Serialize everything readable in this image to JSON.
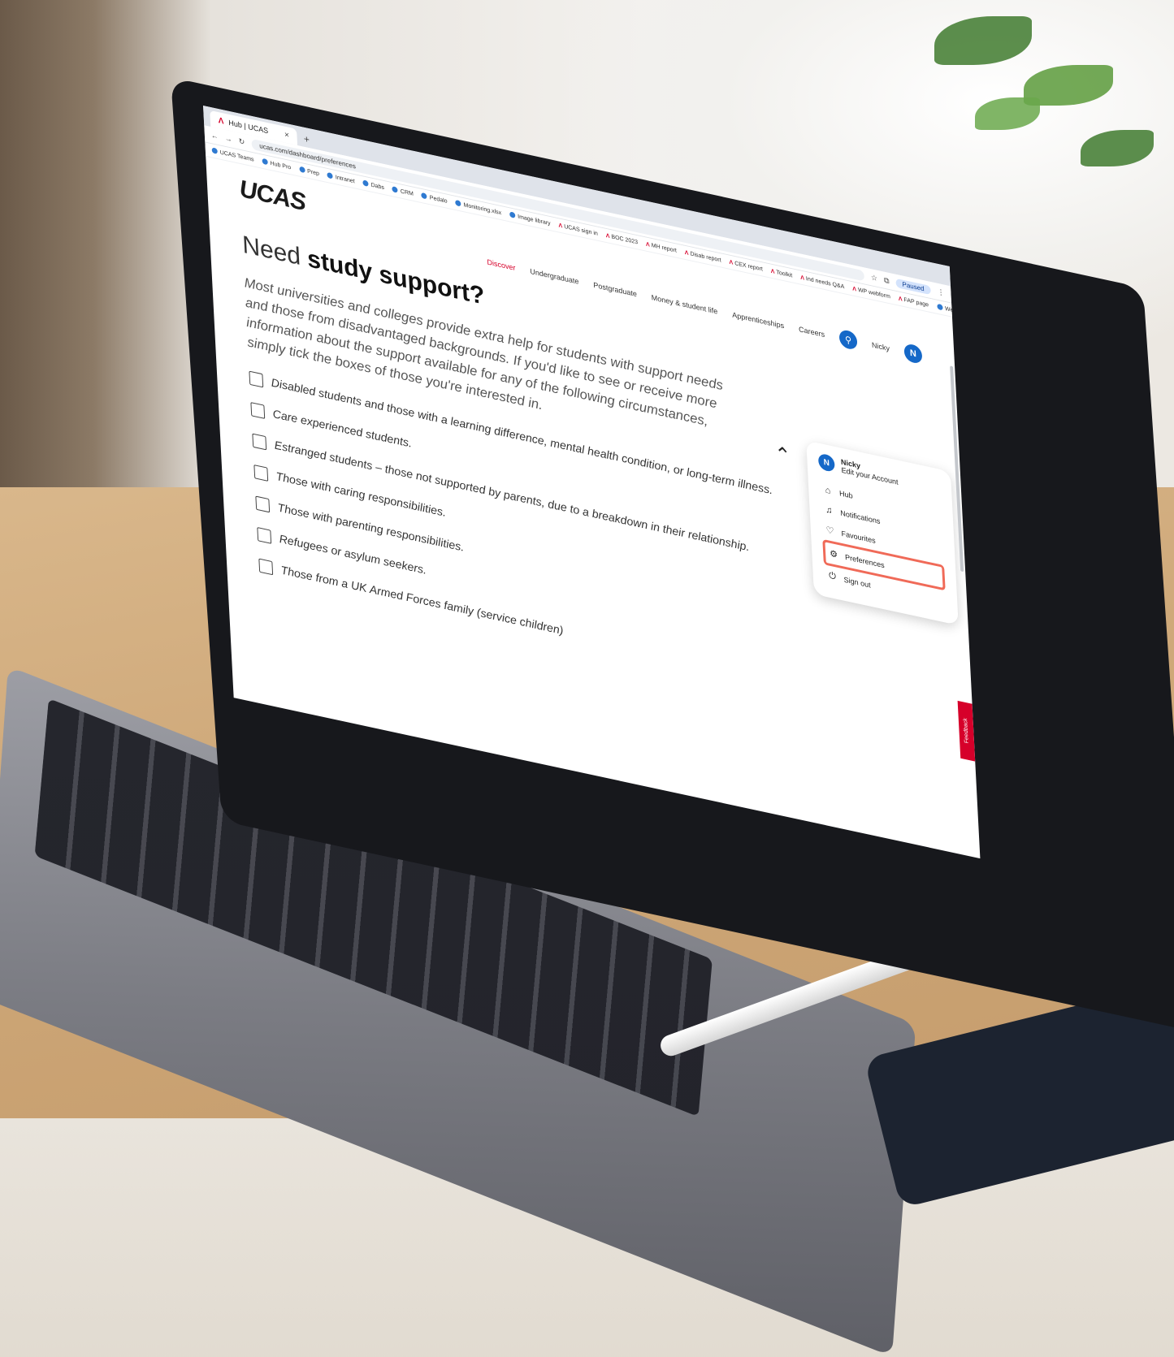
{
  "browser": {
    "tab_title": "Hub | UCAS",
    "tab_close": "×",
    "new_tab": "+",
    "url": "ucas.com/dashboard/preferences",
    "profile_label": "Paused",
    "bookmarks": [
      {
        "label": "UCAS Teams",
        "icon": "grid-icon"
      },
      {
        "label": "Hub Pro",
        "icon": "globe-icon"
      },
      {
        "label": "Prep",
        "icon": "globe-icon"
      },
      {
        "label": "Intranet",
        "icon": "globe-icon"
      },
      {
        "label": "Dabs",
        "icon": "app-icon"
      },
      {
        "label": "CRM",
        "icon": "cloud-icon"
      },
      {
        "label": "Pedalo",
        "icon": "globe-icon"
      },
      {
        "label": "Monitoring.xlsx",
        "icon": "excel-icon"
      },
      {
        "label": "Image library",
        "icon": "globe-icon"
      },
      {
        "label": "UCAS sign in",
        "icon": "ucas-icon"
      },
      {
        "label": "BOC 2023",
        "icon": "ucas-icon"
      },
      {
        "label": "MH report",
        "icon": "ucas-icon"
      },
      {
        "label": "Disab report",
        "icon": "ucas-icon"
      },
      {
        "label": "CEX report",
        "icon": "ucas-icon"
      },
      {
        "label": "Toolkit",
        "icon": "ucas-icon"
      },
      {
        "label": "Ind needs Q&A",
        "icon": "ucas-icon"
      },
      {
        "label": "WP webform",
        "icon": "ucas-icon"
      },
      {
        "label": "FAP page",
        "icon": "ucas-icon"
      },
      {
        "label": "WeTransfer",
        "icon": "wetransfer-icon"
      }
    ]
  },
  "site": {
    "logo": "UCAS",
    "nav": [
      "Discover",
      "Undergraduate",
      "Postgraduate",
      "Money & student life",
      "Apprenticeships",
      "Careers"
    ],
    "active_nav": "Discover",
    "user_name": "Nicky",
    "avatar_initial": "N"
  },
  "content": {
    "heading_light": "Need ",
    "heading_bold": "study support?",
    "intro": "Most universities and colleges provide extra help for students with support needs and those from disadvantaged backgrounds. If you'd like to see or receive more information about the support available for any of the following circumstances, simply tick the boxes of those you're interested in.",
    "options": [
      "Disabled students and those with a learning difference, mental health condition, or long-term illness.",
      "Care experienced students.",
      "Estranged students – those not supported by parents, due to a breakdown in their relationship.",
      "Those with caring responsibilities.",
      "Those with parenting responsibilities.",
      "Refugees or asylum seekers.",
      "Those from a UK Armed Forces family (service children)"
    ]
  },
  "user_menu": {
    "name": "Nicky",
    "edit_account": "Edit your Account",
    "items": [
      {
        "label": "Hub",
        "icon": "home-icon"
      },
      {
        "label": "Notifications",
        "icon": "bell-icon"
      },
      {
        "label": "Favourites",
        "icon": "heart-icon"
      },
      {
        "label": "Preferences",
        "icon": "gear-icon",
        "highlighted": true
      },
      {
        "label": "Sign out",
        "icon": "power-icon"
      }
    ]
  },
  "feedback_tab": "Feedback",
  "colors": {
    "brand_red": "#d6002a",
    "accent_blue": "#1568c8",
    "highlight": "#f06a58"
  }
}
